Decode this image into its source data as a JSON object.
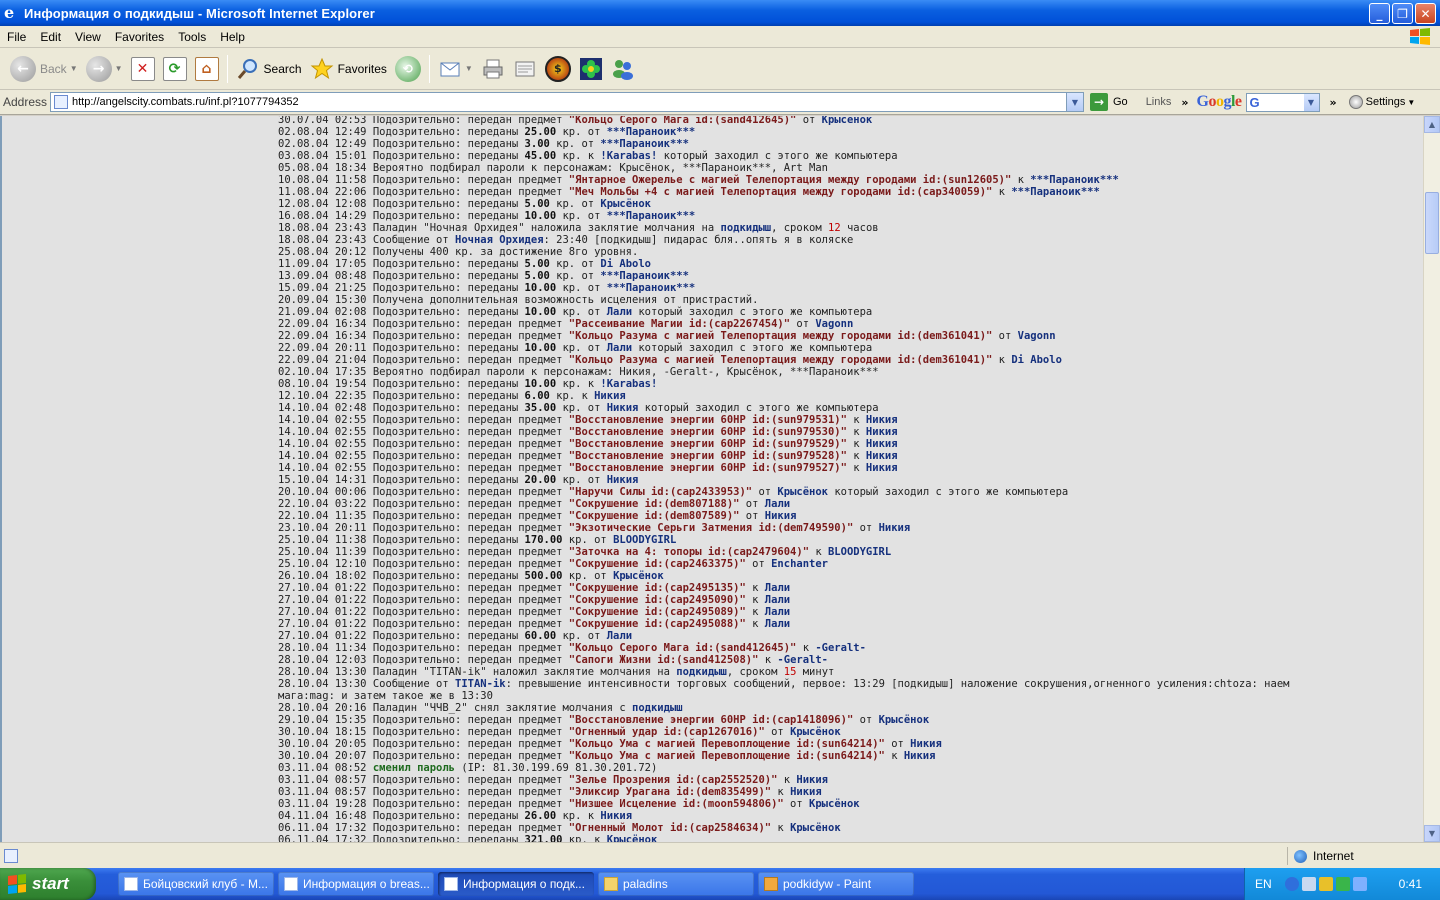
{
  "window": {
    "title": "Информация о подкидыш - Microsoft Internet Explorer"
  },
  "menu": [
    "File",
    "Edit",
    "View",
    "Favorites",
    "Tools",
    "Help"
  ],
  "toolbar": {
    "back": "Back",
    "search": "Search",
    "favorites": "Favorites"
  },
  "address": {
    "label": "Address",
    "url": "http://angelscity.combats.ru/inf.pl?1077794352",
    "go": "Go",
    "links": "Links",
    "settings": "Settings"
  },
  "google": {
    "logo": [
      "G",
      "o",
      "o",
      "g",
      "l",
      "e"
    ],
    "select": "G"
  },
  "log_lines": [
    [
      {
        "t": "30.07.04 02:53 Подозрительно: передан предмет "
      },
      {
        "t": "\"Кольцо Серого Мага id:(sand412645)\"",
        "c": "it"
      },
      {
        "t": " от "
      },
      {
        "t": "Крысёнок",
        "c": "nm"
      }
    ],
    [
      {
        "t": "02.08.04 12:49 Подозрительно: переданы "
      },
      {
        "t": "25.00",
        "c": "num"
      },
      {
        "t": " кр. от "
      },
      {
        "t": "***Параноик***",
        "c": "nm"
      }
    ],
    [
      {
        "t": "02.08.04 12:49 Подозрительно: переданы "
      },
      {
        "t": "3.00",
        "c": "num"
      },
      {
        "t": " кр. от "
      },
      {
        "t": "***Параноик***",
        "c": "nm"
      }
    ],
    [
      {
        "t": "03.08.04 15:01 Подозрительно: переданы "
      },
      {
        "t": "45.00",
        "c": "num"
      },
      {
        "t": " кр. к "
      },
      {
        "t": "!Karabas!",
        "c": "nm"
      },
      {
        "t": " который заходил с этого же компьютера"
      }
    ],
    [
      {
        "t": "05.08.04 18:34 Вероятно подбирал пароли к персонажам: Крысёнок, ***Параноик***, Art Man"
      }
    ],
    [
      {
        "t": "10.08.04 11:58 Подозрительно: передан предмет "
      },
      {
        "t": "\"Янтарное Ожерелье с магией Телепортация между городами id:(sun12605)\"",
        "c": "it"
      },
      {
        "t": " к "
      },
      {
        "t": "***Параноик***",
        "c": "nm"
      }
    ],
    [
      {
        "t": "11.08.04 22:06 Подозрительно: передан предмет "
      },
      {
        "t": "\"Меч Мольбы +4 с магией Телепортация между городами id:(cap340059)\"",
        "c": "it"
      },
      {
        "t": " к "
      },
      {
        "t": "***Параноик***",
        "c": "nm"
      }
    ],
    [
      {
        "t": "12.08.04 12:08 Подозрительно: переданы "
      },
      {
        "t": "5.00",
        "c": "num"
      },
      {
        "t": " кр. от "
      },
      {
        "t": "Крысёнок",
        "c": "nm"
      }
    ],
    [
      {
        "t": "16.08.04 14:29 Подозрительно: переданы "
      },
      {
        "t": "10.00",
        "c": "num"
      },
      {
        "t": " кр. от "
      },
      {
        "t": "***Параноик***",
        "c": "nm"
      }
    ],
    [
      {
        "t": "18.08.04 23:43 Паладин \"Ночная Орхидея\" наложила заклятие молчания на "
      },
      {
        "t": "подкидыш",
        "c": "nm"
      },
      {
        "t": ", сроком "
      },
      {
        "t": "12",
        "c": "red"
      },
      {
        "t": " часов"
      }
    ],
    [
      {
        "t": "18.08.04 23:43 Сообщение от "
      },
      {
        "t": "Ночная Орхидея",
        "c": "nm"
      },
      {
        "t": ": 23:40 [подкидыш] пидарас бля..опять я в коляске"
      }
    ],
    [
      {
        "t": "25.08.04 20:12 Получены 400 кр. за достижение 8го уровня."
      }
    ],
    [
      {
        "t": "11.09.04 17:05 Подозрительно: переданы "
      },
      {
        "t": "5.00",
        "c": "num"
      },
      {
        "t": " кр. от "
      },
      {
        "t": "Di Abolo",
        "c": "nm"
      }
    ],
    [
      {
        "t": "13.09.04 08:48 Подозрительно: переданы "
      },
      {
        "t": "5.00",
        "c": "num"
      },
      {
        "t": " кр. от "
      },
      {
        "t": "***Параноик***",
        "c": "nm"
      }
    ],
    [
      {
        "t": "15.09.04 21:25 Подозрительно: переданы "
      },
      {
        "t": "10.00",
        "c": "num"
      },
      {
        "t": " кр. от "
      },
      {
        "t": "***Параноик***",
        "c": "nm"
      }
    ],
    [
      {
        "t": "20.09.04 15:30 Получена дополнительная возможность исцеления от пристрастий."
      }
    ],
    [
      {
        "t": "21.09.04 02:08 Подозрительно: переданы "
      },
      {
        "t": "10.00",
        "c": "num"
      },
      {
        "t": " кр. от "
      },
      {
        "t": "Лали",
        "c": "nm"
      },
      {
        "t": " который заходил с этого же компьютера"
      }
    ],
    [
      {
        "t": "22.09.04 16:34 Подозрительно: передан предмет "
      },
      {
        "t": "\"Рассеивание Магии id:(cap2267454)\"",
        "c": "it"
      },
      {
        "t": " от "
      },
      {
        "t": "Vagonn",
        "c": "nm"
      }
    ],
    [
      {
        "t": "22.09.04 16:34 Подозрительно: передан предмет "
      },
      {
        "t": "\"Кольцо Разума с магией Телепортация между городами id:(dem361041)\"",
        "c": "it"
      },
      {
        "t": " от "
      },
      {
        "t": "Vagonn",
        "c": "nm"
      }
    ],
    [
      {
        "t": "22.09.04 20:11 Подозрительно: переданы "
      },
      {
        "t": "10.00",
        "c": "num"
      },
      {
        "t": " кр. от "
      },
      {
        "t": "Лали",
        "c": "nm"
      },
      {
        "t": " который заходил с этого же компьютера"
      }
    ],
    [
      {
        "t": "22.09.04 21:04 Подозрительно: передан предмет "
      },
      {
        "t": "\"Кольцо Разума с магией Телепортация между городами id:(dem361041)\"",
        "c": "it"
      },
      {
        "t": " к "
      },
      {
        "t": "Di Abolo",
        "c": "nm"
      }
    ],
    [
      {
        "t": "02.10.04 17:35 Вероятно подбирал пароли к персонажам: Никия, -Geralt-, Крысёнок, ***Параноик***"
      }
    ],
    [
      {
        "t": "08.10.04 19:54 Подозрительно: переданы "
      },
      {
        "t": "10.00",
        "c": "num"
      },
      {
        "t": " кр. к "
      },
      {
        "t": "!Karabas!",
        "c": "nm"
      }
    ],
    [
      {
        "t": "12.10.04 22:35 Подозрительно: переданы "
      },
      {
        "t": "6.00",
        "c": "num"
      },
      {
        "t": " кр. к "
      },
      {
        "t": "Никия",
        "c": "nm"
      }
    ],
    [
      {
        "t": "14.10.04 02:48 Подозрительно: переданы "
      },
      {
        "t": "35.00",
        "c": "num"
      },
      {
        "t": " кр. от "
      },
      {
        "t": "Никия",
        "c": "nm"
      },
      {
        "t": " который заходил с этого же компьютера"
      }
    ],
    [
      {
        "t": "14.10.04 02:55 Подозрительно: передан предмет "
      },
      {
        "t": "\"Восстановление энергии 60HP id:(sun979531)\"",
        "c": "it"
      },
      {
        "t": " к "
      },
      {
        "t": "Никия",
        "c": "nm"
      }
    ],
    [
      {
        "t": "14.10.04 02:55 Подозрительно: передан предмет "
      },
      {
        "t": "\"Восстановление энергии 60HP id:(sun979530)\"",
        "c": "it"
      },
      {
        "t": " к "
      },
      {
        "t": "Никия",
        "c": "nm"
      }
    ],
    [
      {
        "t": "14.10.04 02:55 Подозрительно: передан предмет "
      },
      {
        "t": "\"Восстановление энергии 60HP id:(sun979529)\"",
        "c": "it"
      },
      {
        "t": " к "
      },
      {
        "t": "Никия",
        "c": "nm"
      }
    ],
    [
      {
        "t": "14.10.04 02:55 Подозрительно: передан предмет "
      },
      {
        "t": "\"Восстановление энергии 60HP id:(sun979528)\"",
        "c": "it"
      },
      {
        "t": " к "
      },
      {
        "t": "Никия",
        "c": "nm"
      }
    ],
    [
      {
        "t": "14.10.04 02:55 Подозрительно: передан предмет "
      },
      {
        "t": "\"Восстановление энергии 60HP id:(sun979527)\"",
        "c": "it"
      },
      {
        "t": " к "
      },
      {
        "t": "Никия",
        "c": "nm"
      }
    ],
    [
      {
        "t": "15.10.04 14:31 Подозрительно: переданы "
      },
      {
        "t": "20.00",
        "c": "num"
      },
      {
        "t": " кр. от "
      },
      {
        "t": "Никия",
        "c": "nm"
      }
    ],
    [
      {
        "t": "20.10.04 00:06 Подозрительно: передан предмет "
      },
      {
        "t": "\"Наручи Силы id:(cap2433953)\"",
        "c": "it"
      },
      {
        "t": " от "
      },
      {
        "t": "Крысёнок",
        "c": "nm"
      },
      {
        "t": " который заходил с этого же компьютера"
      }
    ],
    [
      {
        "t": "22.10.04 03:22 Подозрительно: передан предмет "
      },
      {
        "t": "\"Сокрушение id:(dem807188)\"",
        "c": "it"
      },
      {
        "t": " от "
      },
      {
        "t": "Лали",
        "c": "nm"
      }
    ],
    [
      {
        "t": "22.10.04 11:35 Подозрительно: передан предмет "
      },
      {
        "t": "\"Сокрушение id:(dem807589)\"",
        "c": "it"
      },
      {
        "t": " от "
      },
      {
        "t": "Никия",
        "c": "nm"
      }
    ],
    [
      {
        "t": "23.10.04 20:11 Подозрительно: передан предмет "
      },
      {
        "t": "\"Экзотические Серьги Затмения id:(dem749590)\"",
        "c": "it"
      },
      {
        "t": " от "
      },
      {
        "t": "Никия",
        "c": "nm"
      }
    ],
    [
      {
        "t": "25.10.04 11:38 Подозрительно: переданы "
      },
      {
        "t": "170.00",
        "c": "num"
      },
      {
        "t": " кр. от "
      },
      {
        "t": "BLOODYGIRL",
        "c": "nm"
      }
    ],
    [
      {
        "t": "25.10.04 11:39 Подозрительно: передан предмет "
      },
      {
        "t": "\"Заточка на 4: топоры id:(cap2479604)\"",
        "c": "it"
      },
      {
        "t": " к "
      },
      {
        "t": "BLOODYGIRL",
        "c": "nm"
      }
    ],
    [
      {
        "t": "25.10.04 12:10 Подозрительно: передан предмет "
      },
      {
        "t": "\"Сокрушение id:(cap2463375)\"",
        "c": "it"
      },
      {
        "t": " от "
      },
      {
        "t": "Enchanter",
        "c": "nm"
      }
    ],
    [
      {
        "t": "26.10.04 18:02 Подозрительно: переданы "
      },
      {
        "t": "500.00",
        "c": "num"
      },
      {
        "t": " кр. от "
      },
      {
        "t": "Крысёнок",
        "c": "nm"
      }
    ],
    [
      {
        "t": "27.10.04 01:22 Подозрительно: передан предмет "
      },
      {
        "t": "\"Сокрушение id:(cap2495135)\"",
        "c": "it"
      },
      {
        "t": " к "
      },
      {
        "t": "Лали",
        "c": "nm"
      }
    ],
    [
      {
        "t": "27.10.04 01:22 Подозрительно: передан предмет "
      },
      {
        "t": "\"Сокрушение id:(cap2495090)\"",
        "c": "it"
      },
      {
        "t": " к "
      },
      {
        "t": "Лали",
        "c": "nm"
      }
    ],
    [
      {
        "t": "27.10.04 01:22 Подозрительно: передан предмет "
      },
      {
        "t": "\"Сокрушение id:(cap2495089)\"",
        "c": "it"
      },
      {
        "t": " к "
      },
      {
        "t": "Лали",
        "c": "nm"
      }
    ],
    [
      {
        "t": "27.10.04 01:22 Подозрительно: передан предмет "
      },
      {
        "t": "\"Сокрушение id:(cap2495088)\"",
        "c": "it"
      },
      {
        "t": " к "
      },
      {
        "t": "Лали",
        "c": "nm"
      }
    ],
    [
      {
        "t": "27.10.04 01:22 Подозрительно: переданы "
      },
      {
        "t": "60.00",
        "c": "num"
      },
      {
        "t": " кр. от "
      },
      {
        "t": "Лали",
        "c": "nm"
      }
    ],
    [
      {
        "t": "28.10.04 11:34 Подозрительно: передан предмет "
      },
      {
        "t": "\"Кольцо Серого Мага id:(sand412645)\"",
        "c": "it"
      },
      {
        "t": " к "
      },
      {
        "t": "-Geralt-",
        "c": "nm"
      }
    ],
    [
      {
        "t": "28.10.04 12:03 Подозрительно: передан предмет "
      },
      {
        "t": "\"Сапоги Жизни id:(sand412508)\"",
        "c": "it"
      },
      {
        "t": " к "
      },
      {
        "t": "-Geralt-",
        "c": "nm"
      }
    ],
    [
      {
        "t": "28.10.04 13:30 Паладин \"TITAN-ik\" наложил заклятие молчания на "
      },
      {
        "t": "подкидыш",
        "c": "nm"
      },
      {
        "t": ", сроком "
      },
      {
        "t": "15",
        "c": "red"
      },
      {
        "t": " минут"
      }
    ],
    [
      {
        "t": "28.10.04 13:30 Сообщение от "
      },
      {
        "t": "TITAN-ik",
        "c": "nm"
      },
      {
        "t": ": превышение интенсивности торговых сообщений, первое: 13:29 [подкидыш] наложение сокрушения,огненного усиления:chtoza: наем мага:mag: и затем такое же в 13:30"
      }
    ],
    [
      {
        "t": "28.10.04 20:16 Паладин \"ЧЧВ_2\" снял заклятие молчания с "
      },
      {
        "t": "подкидыш",
        "c": "nm"
      }
    ],
    [
      {
        "t": "29.10.04 15:35 Подозрительно: передан предмет "
      },
      {
        "t": "\"Восстановление энергии 60HP id:(cap1418096)\"",
        "c": "it"
      },
      {
        "t": " от "
      },
      {
        "t": "Крысёнок",
        "c": "nm"
      }
    ],
    [
      {
        "t": "30.10.04 18:15 Подозрительно: передан предмет "
      },
      {
        "t": "\"Огненный удар id:(cap1267016)\"",
        "c": "it"
      },
      {
        "t": " от "
      },
      {
        "t": "Крысёнок",
        "c": "nm"
      }
    ],
    [
      {
        "t": "30.10.04 20:05 Подозрительно: передан предмет "
      },
      {
        "t": "\"Кольцо Ума с магией Перевоплощение id:(sun64214)\"",
        "c": "it"
      },
      {
        "t": " от "
      },
      {
        "t": "Никия",
        "c": "nm"
      }
    ],
    [
      {
        "t": "30.10.04 20:07 Подозрительно: передан предмет "
      },
      {
        "t": "\"Кольцо Ума с магией Перевоплощение id:(sun64214)\"",
        "c": "it"
      },
      {
        "t": " к "
      },
      {
        "t": "Никия",
        "c": "nm"
      }
    ],
    [
      {
        "t": "03.11.04 08:52 "
      },
      {
        "t": "сменил пароль",
        "c": "grn"
      },
      {
        "t": " (IP: 81.30.199.69 81.30.201.72)"
      }
    ],
    [
      {
        "t": "03.11.04 08:57 Подозрительно: передан предмет "
      },
      {
        "t": "\"Зелье Прозрения id:(cap2552520)\"",
        "c": "it"
      },
      {
        "t": " к "
      },
      {
        "t": "Никия",
        "c": "nm"
      }
    ],
    [
      {
        "t": "03.11.04 08:57 Подозрительно: передан предмет "
      },
      {
        "t": "\"Эликсир Урагана id:(dem835499)\"",
        "c": "it"
      },
      {
        "t": " к "
      },
      {
        "t": "Никия",
        "c": "nm"
      }
    ],
    [
      {
        "t": "03.11.04 19:28 Подозрительно: передан предмет "
      },
      {
        "t": "\"Низшее Исцеление id:(moon594806)\"",
        "c": "it"
      },
      {
        "t": " от "
      },
      {
        "t": "Крысёнок",
        "c": "nm"
      }
    ],
    [
      {
        "t": "04.11.04 16:48 Подозрительно: переданы "
      },
      {
        "t": "26.00",
        "c": "num"
      },
      {
        "t": " кр. к "
      },
      {
        "t": "Никия",
        "c": "nm"
      }
    ],
    [
      {
        "t": "06.11.04 17:32 Подозрительно: передан предмет "
      },
      {
        "t": "\"Огненный Молот id:(cap2584634)\"",
        "c": "it"
      },
      {
        "t": " к "
      },
      {
        "t": "Крысёнок",
        "c": "nm"
      }
    ],
    [
      {
        "t": "06.11.04 17:32 Подозрительно: переданы "
      },
      {
        "t": "321.00",
        "c": "num"
      },
      {
        "t": " кр. к "
      },
      {
        "t": "Крысёнок",
        "c": "nm"
      }
    ]
  ],
  "status": {
    "zone": "Internet"
  },
  "taskbar": {
    "start": "start",
    "tasks": [
      {
        "label": "Бойцовский клуб - M...",
        "icon": "ie-icon"
      },
      {
        "label": "Информация о breas...",
        "icon": "ie-icon"
      },
      {
        "label": "Информация о подк...",
        "icon": "ie-icon",
        "active": true
      },
      {
        "label": "paladins",
        "icon": "folder-icon"
      },
      {
        "label": "podkidyw - Paint",
        "icon": "paint-icon"
      }
    ],
    "lang": "EN",
    "clock": "0:41"
  }
}
